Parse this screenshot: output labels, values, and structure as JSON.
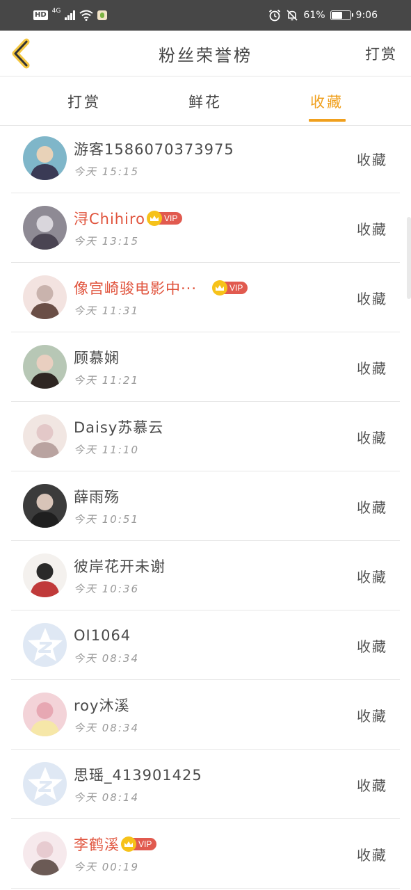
{
  "status_bar": {
    "hd": "HD",
    "network": "4G",
    "battery_percent": "61%",
    "battery_level": 0.61,
    "time": "9:06"
  },
  "header": {
    "title": "粉丝荣誉榜",
    "right_action": "打赏",
    "back_icon": "chevron-left-icon"
  },
  "tabs": [
    {
      "label": "打赏",
      "active": false
    },
    {
      "label": "鲜花",
      "active": false
    },
    {
      "label": "收藏",
      "active": true
    }
  ],
  "colors": {
    "accent": "#f0a01e",
    "vip_name": "#e0533c",
    "vip_tag": "#e15a4f",
    "status_bar": "#474747"
  },
  "list": [
    {
      "name": "游客1586070373975",
      "time": "今天 15:15",
      "action": "收藏",
      "vip": false,
      "vip_label": "",
      "avatar": "photo"
    },
    {
      "name": "浔Chihiro",
      "time": "今天 13:15",
      "action": "收藏",
      "vip": true,
      "vip_label": "VIP",
      "avatar": "photo"
    },
    {
      "name": "像宫崎骏电影中···",
      "time": "今天 11:31",
      "action": "收藏",
      "vip": true,
      "vip_label": "VIP",
      "avatar": "photo"
    },
    {
      "name": "顾慕娴",
      "time": "今天 11:21",
      "action": "收藏",
      "vip": false,
      "vip_label": "",
      "avatar": "photo"
    },
    {
      "name": "Daisy苏慕云",
      "time": "今天 11:10",
      "action": "收藏",
      "vip": false,
      "vip_label": "",
      "avatar": "photo"
    },
    {
      "name": "薛雨殇",
      "time": "今天 10:51",
      "action": "收藏",
      "vip": false,
      "vip_label": "",
      "avatar": "photo"
    },
    {
      "name": "彼岸花开未谢",
      "time": "今天 10:36",
      "action": "收藏",
      "vip": false,
      "vip_label": "",
      "avatar": "photo"
    },
    {
      "name": "OI1064",
      "time": "今天 08:34",
      "action": "收藏",
      "vip": false,
      "vip_label": "",
      "avatar": "default"
    },
    {
      "name": "roy沐溪",
      "time": "今天 08:34",
      "action": "收藏",
      "vip": false,
      "vip_label": "",
      "avatar": "photo"
    },
    {
      "name": "思瑶_413901425",
      "time": "今天 08:14",
      "action": "收藏",
      "vip": false,
      "vip_label": "",
      "avatar": "default"
    },
    {
      "name": "李鹤溪",
      "time": "今天 00:19",
      "action": "收藏",
      "vip": true,
      "vip_label": "VIP",
      "avatar": "photo"
    }
  ]
}
